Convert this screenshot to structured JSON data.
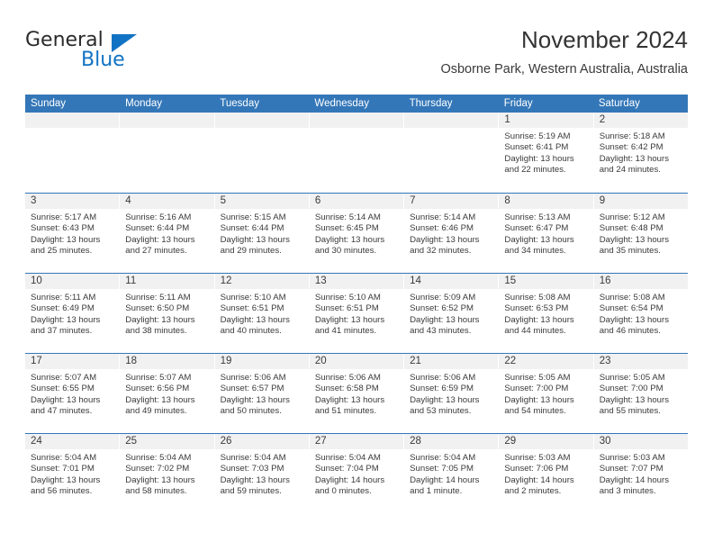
{
  "brand": {
    "name_part1": "General",
    "name_part2": "Blue",
    "triangle_color": "#1273c4"
  },
  "header": {
    "title": "November 2024",
    "subtitle": "Osborne Park, Western Australia, Australia"
  },
  "theme": {
    "header_blue": "#3477b8",
    "daynum_band": "#f1f1f1",
    "text": "#3a3a3a"
  },
  "weekdays": [
    "Sunday",
    "Monday",
    "Tuesday",
    "Wednesday",
    "Thursday",
    "Friday",
    "Saturday"
  ],
  "weeks": [
    [
      {
        "day": "",
        "lines": []
      },
      {
        "day": "",
        "lines": []
      },
      {
        "day": "",
        "lines": []
      },
      {
        "day": "",
        "lines": []
      },
      {
        "day": "",
        "lines": []
      },
      {
        "day": "1",
        "lines": [
          "Sunrise: 5:19 AM",
          "Sunset: 6:41 PM",
          "Daylight: 13 hours",
          "and 22 minutes."
        ]
      },
      {
        "day": "2",
        "lines": [
          "Sunrise: 5:18 AM",
          "Sunset: 6:42 PM",
          "Daylight: 13 hours",
          "and 24 minutes."
        ]
      }
    ],
    [
      {
        "day": "3",
        "lines": [
          "Sunrise: 5:17 AM",
          "Sunset: 6:43 PM",
          "Daylight: 13 hours",
          "and 25 minutes."
        ]
      },
      {
        "day": "4",
        "lines": [
          "Sunrise: 5:16 AM",
          "Sunset: 6:44 PM",
          "Daylight: 13 hours",
          "and 27 minutes."
        ]
      },
      {
        "day": "5",
        "lines": [
          "Sunrise: 5:15 AM",
          "Sunset: 6:44 PM",
          "Daylight: 13 hours",
          "and 29 minutes."
        ]
      },
      {
        "day": "6",
        "lines": [
          "Sunrise: 5:14 AM",
          "Sunset: 6:45 PM",
          "Daylight: 13 hours",
          "and 30 minutes."
        ]
      },
      {
        "day": "7",
        "lines": [
          "Sunrise: 5:14 AM",
          "Sunset: 6:46 PM",
          "Daylight: 13 hours",
          "and 32 minutes."
        ]
      },
      {
        "day": "8",
        "lines": [
          "Sunrise: 5:13 AM",
          "Sunset: 6:47 PM",
          "Daylight: 13 hours",
          "and 34 minutes."
        ]
      },
      {
        "day": "9",
        "lines": [
          "Sunrise: 5:12 AM",
          "Sunset: 6:48 PM",
          "Daylight: 13 hours",
          "and 35 minutes."
        ]
      }
    ],
    [
      {
        "day": "10",
        "lines": [
          "Sunrise: 5:11 AM",
          "Sunset: 6:49 PM",
          "Daylight: 13 hours",
          "and 37 minutes."
        ]
      },
      {
        "day": "11",
        "lines": [
          "Sunrise: 5:11 AM",
          "Sunset: 6:50 PM",
          "Daylight: 13 hours",
          "and 38 minutes."
        ]
      },
      {
        "day": "12",
        "lines": [
          "Sunrise: 5:10 AM",
          "Sunset: 6:51 PM",
          "Daylight: 13 hours",
          "and 40 minutes."
        ]
      },
      {
        "day": "13",
        "lines": [
          "Sunrise: 5:10 AM",
          "Sunset: 6:51 PM",
          "Daylight: 13 hours",
          "and 41 minutes."
        ]
      },
      {
        "day": "14",
        "lines": [
          "Sunrise: 5:09 AM",
          "Sunset: 6:52 PM",
          "Daylight: 13 hours",
          "and 43 minutes."
        ]
      },
      {
        "day": "15",
        "lines": [
          "Sunrise: 5:08 AM",
          "Sunset: 6:53 PM",
          "Daylight: 13 hours",
          "and 44 minutes."
        ]
      },
      {
        "day": "16",
        "lines": [
          "Sunrise: 5:08 AM",
          "Sunset: 6:54 PM",
          "Daylight: 13 hours",
          "and 46 minutes."
        ]
      }
    ],
    [
      {
        "day": "17",
        "lines": [
          "Sunrise: 5:07 AM",
          "Sunset: 6:55 PM",
          "Daylight: 13 hours",
          "and 47 minutes."
        ]
      },
      {
        "day": "18",
        "lines": [
          "Sunrise: 5:07 AM",
          "Sunset: 6:56 PM",
          "Daylight: 13 hours",
          "and 49 minutes."
        ]
      },
      {
        "day": "19",
        "lines": [
          "Sunrise: 5:06 AM",
          "Sunset: 6:57 PM",
          "Daylight: 13 hours",
          "and 50 minutes."
        ]
      },
      {
        "day": "20",
        "lines": [
          "Sunrise: 5:06 AM",
          "Sunset: 6:58 PM",
          "Daylight: 13 hours",
          "and 51 minutes."
        ]
      },
      {
        "day": "21",
        "lines": [
          "Sunrise: 5:06 AM",
          "Sunset: 6:59 PM",
          "Daylight: 13 hours",
          "and 53 minutes."
        ]
      },
      {
        "day": "22",
        "lines": [
          "Sunrise: 5:05 AM",
          "Sunset: 7:00 PM",
          "Daylight: 13 hours",
          "and 54 minutes."
        ]
      },
      {
        "day": "23",
        "lines": [
          "Sunrise: 5:05 AM",
          "Sunset: 7:00 PM",
          "Daylight: 13 hours",
          "and 55 minutes."
        ]
      }
    ],
    [
      {
        "day": "24",
        "lines": [
          "Sunrise: 5:04 AM",
          "Sunset: 7:01 PM",
          "Daylight: 13 hours",
          "and 56 minutes."
        ]
      },
      {
        "day": "25",
        "lines": [
          "Sunrise: 5:04 AM",
          "Sunset: 7:02 PM",
          "Daylight: 13 hours",
          "and 58 minutes."
        ]
      },
      {
        "day": "26",
        "lines": [
          "Sunrise: 5:04 AM",
          "Sunset: 7:03 PM",
          "Daylight: 13 hours",
          "and 59 minutes."
        ]
      },
      {
        "day": "27",
        "lines": [
          "Sunrise: 5:04 AM",
          "Sunset: 7:04 PM",
          "Daylight: 14 hours",
          "and 0 minutes."
        ]
      },
      {
        "day": "28",
        "lines": [
          "Sunrise: 5:04 AM",
          "Sunset: 7:05 PM",
          "Daylight: 14 hours",
          "and 1 minute."
        ]
      },
      {
        "day": "29",
        "lines": [
          "Sunrise: 5:03 AM",
          "Sunset: 7:06 PM",
          "Daylight: 14 hours",
          "and 2 minutes."
        ]
      },
      {
        "day": "30",
        "lines": [
          "Sunrise: 5:03 AM",
          "Sunset: 7:07 PM",
          "Daylight: 14 hours",
          "and 3 minutes."
        ]
      }
    ]
  ]
}
